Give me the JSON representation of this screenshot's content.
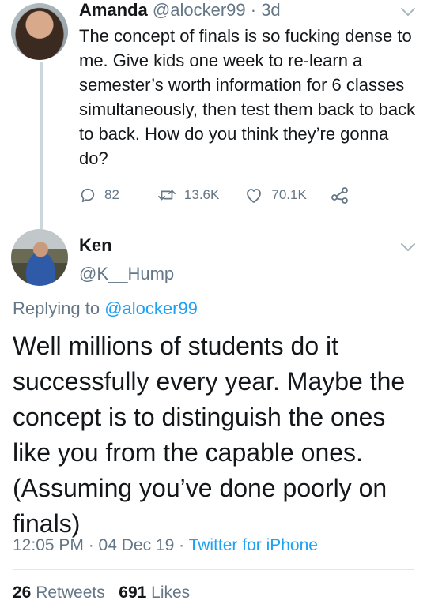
{
  "first_tweet": {
    "display_name": "Amanda",
    "handle_time": "@alocker99 · 3d",
    "body": "The concept of finals is so fucking dense to me. Give kids one week to re-learn a semester’s worth information for 6 classes simultaneously, then test them back to back to back. How do you think they’re gonna do?",
    "actions": {
      "replies": "82",
      "retweets": "13.6K",
      "likes": "70.1K"
    },
    "icons": [
      "reply-icon",
      "retweet-icon",
      "like-icon",
      "share-icon",
      "chevron-down-icon"
    ]
  },
  "reply_tweet": {
    "display_name": "Ken",
    "handle": "@K__Hump",
    "replying_prefix": "Replying to ",
    "replying_to": "@alocker99",
    "body": "Well millions of students do it successfully every year. Maybe the concept is to distinguish the ones like you from the capable ones. (Assuming you’ve done poorly on finals)",
    "timestamp": "12:05 PM · 04 Dec 19 · ",
    "source": "Twitter for iPhone",
    "retweet_count": "26",
    "retweet_label": "Retweets",
    "like_count": "691",
    "like_label": "Likes"
  },
  "colors": {
    "text": "#14171a",
    "secondary": "#657786",
    "link": "#1da1f2",
    "thread_line": "#ccd6dd"
  }
}
